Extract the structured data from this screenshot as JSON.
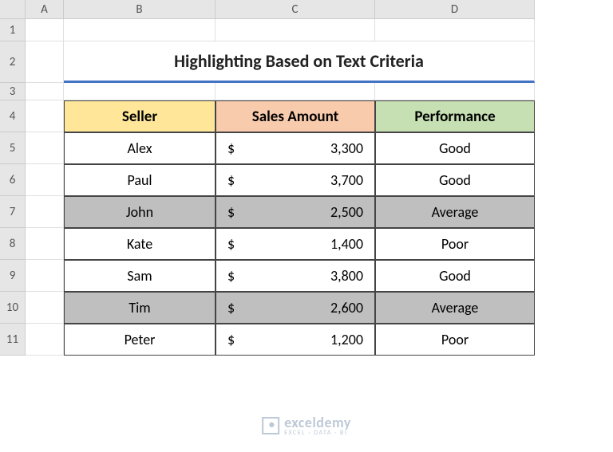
{
  "columns": [
    "A",
    "B",
    "C",
    "D"
  ],
  "rows": [
    "1",
    "2",
    "3",
    "4",
    "5",
    "6",
    "7",
    "8",
    "9",
    "10",
    "11"
  ],
  "title": "Highlighting Based on Text Criteria",
  "headers": {
    "seller": "Seller",
    "amount": "Sales Amount",
    "performance": "Performance"
  },
  "currency": "$",
  "data": [
    {
      "seller": "Alex",
      "amount": "3,300",
      "performance": "Good",
      "highlight": false
    },
    {
      "seller": "Paul",
      "amount": "3,700",
      "performance": "Good",
      "highlight": false
    },
    {
      "seller": "John",
      "amount": "2,500",
      "performance": "Average",
      "highlight": true
    },
    {
      "seller": "Kate",
      "amount": "1,400",
      "performance": "Poor",
      "highlight": false
    },
    {
      "seller": "Sam",
      "amount": "3,800",
      "performance": "Good",
      "highlight": false
    },
    {
      "seller": "Tim",
      "amount": "2,600",
      "performance": "Average",
      "highlight": true
    },
    {
      "seller": "Peter",
      "amount": "1,200",
      "performance": "Poor",
      "highlight": false
    }
  ],
  "watermark": {
    "main": "exceldemy",
    "sub": "EXCEL · DATA · BI"
  },
  "chart_data": {
    "type": "table",
    "title": "Highlighting Based on Text Criteria",
    "columns": [
      "Seller",
      "Sales Amount",
      "Performance"
    ],
    "rows": [
      [
        "Alex",
        3300,
        "Good"
      ],
      [
        "Paul",
        3700,
        "Good"
      ],
      [
        "John",
        2500,
        "Average"
      ],
      [
        "Kate",
        1400,
        "Poor"
      ],
      [
        "Sam",
        3800,
        "Good"
      ],
      [
        "Tim",
        2600,
        "Average"
      ],
      [
        "Peter",
        1200,
        "Poor"
      ]
    ],
    "highlight_rule": "Performance == 'Average'",
    "highlighted_rows": [
      2,
      5
    ]
  }
}
